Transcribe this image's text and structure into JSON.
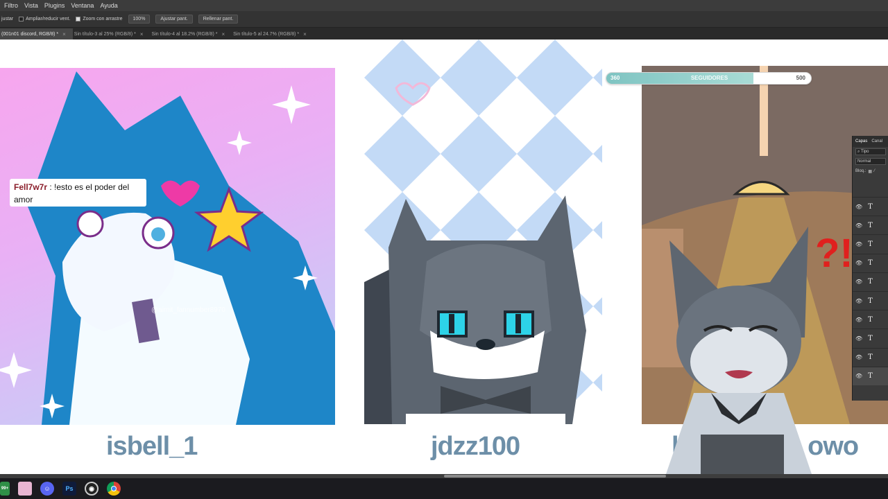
{
  "menubar": {
    "items": [
      "Filtro",
      "Vista",
      "Plugins",
      "Ventana",
      "Ayuda"
    ]
  },
  "options": {
    "cut_label": "justar",
    "resize_windows_label": "Ampliar/reducir vent.",
    "resize_windows_checked": false,
    "scrubby_zoom_label": "Zoom con arrastre",
    "scrubby_zoom_checked": true,
    "zoom_value": "100%",
    "fit_screen_label": "Ajustar pant.",
    "fill_screen_label": "Rellenar pant."
  },
  "tabs": [
    {
      "label": "(001n01 discord, RGB/8) *",
      "active": true
    },
    {
      "label": "Sin título-3 al 25% (RGB/8) *",
      "active": false
    },
    {
      "label": "Sin título-4 al 18.2% (RGB/8) *",
      "active": false
    },
    {
      "label": "Sin título-5 al 24.7% (RGB/8) *",
      "active": false
    }
  ],
  "followers": {
    "current": "360",
    "label": "SEGUIDORES",
    "goal": "500",
    "progress": 0.72
  },
  "chat": {
    "user": "Fell7w7r",
    "message": " : !esto es el poder del amor"
  },
  "cards": [
    {
      "name": "isbell_1"
    },
    {
      "name": "jdzz100"
    },
    {
      "name": "k",
      "name_tail": "owo"
    }
  ],
  "watermark": "@aimit_fannumber8970",
  "layers_panel": {
    "tabs": [
      "Capas",
      "Canal"
    ],
    "filter_label": "Tipo",
    "blend_mode": "Normal",
    "lock_label": "Bloq.:",
    "layer_glyph": "T",
    "layer_count": 10
  },
  "taskbar": {
    "icons": [
      "badge-icon",
      "pink-app-icon",
      "discord-icon",
      "photoshop-icon",
      "obs-icon",
      "chrome-icon"
    ],
    "badge_text": "99+",
    "photoshop_text": "Ps"
  },
  "colors": {
    "name_text": "#6d8fa8",
    "follower_fill": "#7fc4c2",
    "chat_user": "#8a1d2a"
  }
}
